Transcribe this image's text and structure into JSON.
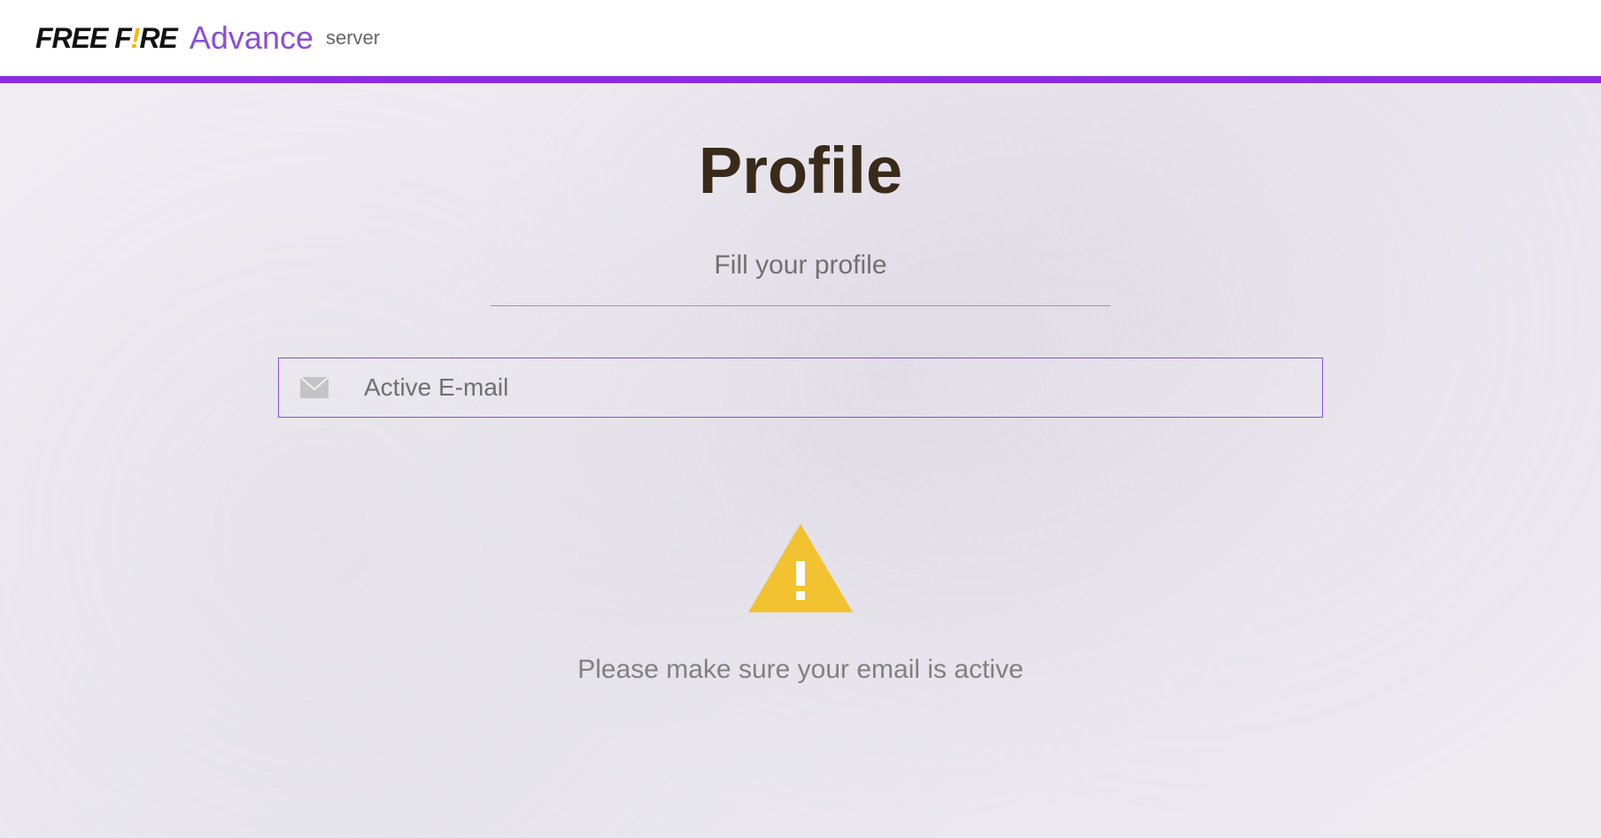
{
  "header": {
    "logo_part1": "FREE F",
    "logo_exclam": "!",
    "logo_part2": "RE",
    "advance_label": "Advance",
    "server_label": "server"
  },
  "profile": {
    "title": "Profile",
    "subtitle": "Fill your profile",
    "email_placeholder": "Active E-mail",
    "email_value": "",
    "warning_text": "Please make sure your email is active"
  },
  "colors": {
    "accent": "#8a2be2",
    "accent_light": "#8a4fd9",
    "warning": "#f2c230",
    "title": "#3a2a1a"
  }
}
